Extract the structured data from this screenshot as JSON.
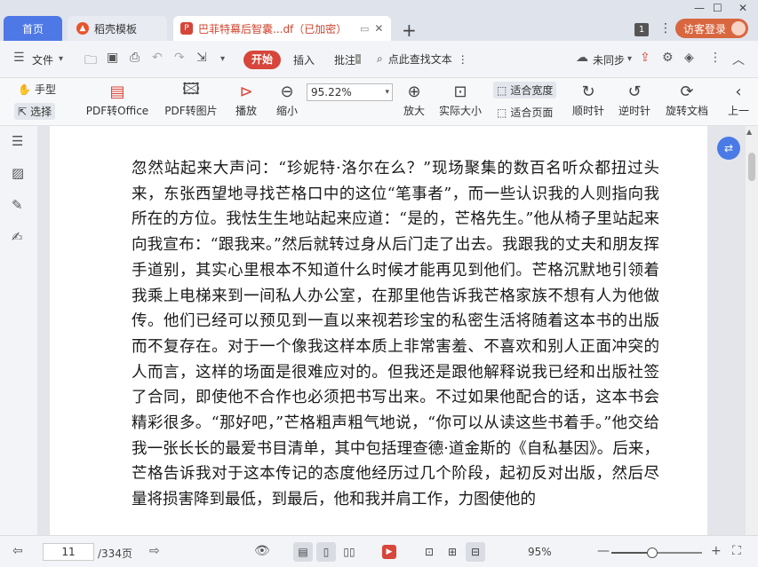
{
  "tabs": {
    "home": "首页",
    "template": "稻壳模板",
    "document": "巴菲特幕后智囊...df（已加密）",
    "add": "+"
  },
  "window": {
    "min": "—",
    "max": "☐",
    "close": "✕",
    "badge": "1",
    "login": "访客登录"
  },
  "menu": {
    "file": "文件",
    "start": "开始",
    "insert": "插入",
    "annotate": "批注",
    "search": "点此查找文本",
    "sync": "未同步"
  },
  "ribbon": {
    "hand": "手型",
    "select": "选择",
    "pdf_to_office": "PDF转Office",
    "pdf_to_image": "PDF转图片",
    "play": "播放",
    "zoom_out": "缩小",
    "zoom_value": "95.22%",
    "zoom_in": "放大",
    "actual_size": "实际大小",
    "fit_width": "适合宽度",
    "fit_page": "适合页面",
    "rotate_cw": "顺时针",
    "rotate_ccw": "逆时针",
    "rotate_doc": "旋转文档",
    "prev": "上一"
  },
  "document": {
    "paragraph": "忽然站起来大声问：“珍妮特·洛尔在么？”现场聚集的数百名听众都扭过头来，东张西望地寻找芒格口中的这位“笔事者”，而一些认识我的人则指向我所在的方位。我怯生生地站起来应道：“是的，芒格先生。”他从椅子里站起来向我宣布：“跟我来。”然后就转过身从后门走了出去。我跟我的丈夫和朋友挥手道别，其实心里根本不知道什么时候才能再见到他们。芒格沉默地引领着我乘上电梯来到一间私人办公室，在那里他告诉我芒格家族不想有人为他做传。他们已经可以预见到一直以来视若珍宝的私密生活将随着这本书的出版而不复存在。对于一个像我这样本质上非常害羞、不喜欢和别人正面冲突的人而言，这样的场面是很难应对的。但我还是跟他解释说我已经和出版社签了合同，即使他不合作也必须把书写出来。不过如果他配合的话，这本书会精彩很多。“那好吧，”芒格粗声粗气地说，“你可以从读这些书着手。”他交给我一张长长的最爱书目清单，其中包括理查德·道金斯的《自私基因》。后来，芒格告诉我对于这本传记的态度他经历过几个阶段，起初反对出版，然后尽量将损害降到最低，到最后，他和我并肩工作，力图使他的"
  },
  "status": {
    "current_page": "11",
    "total_pages": "/334页",
    "zoom_percent": "95%",
    "zoom_level": 0.45
  }
}
